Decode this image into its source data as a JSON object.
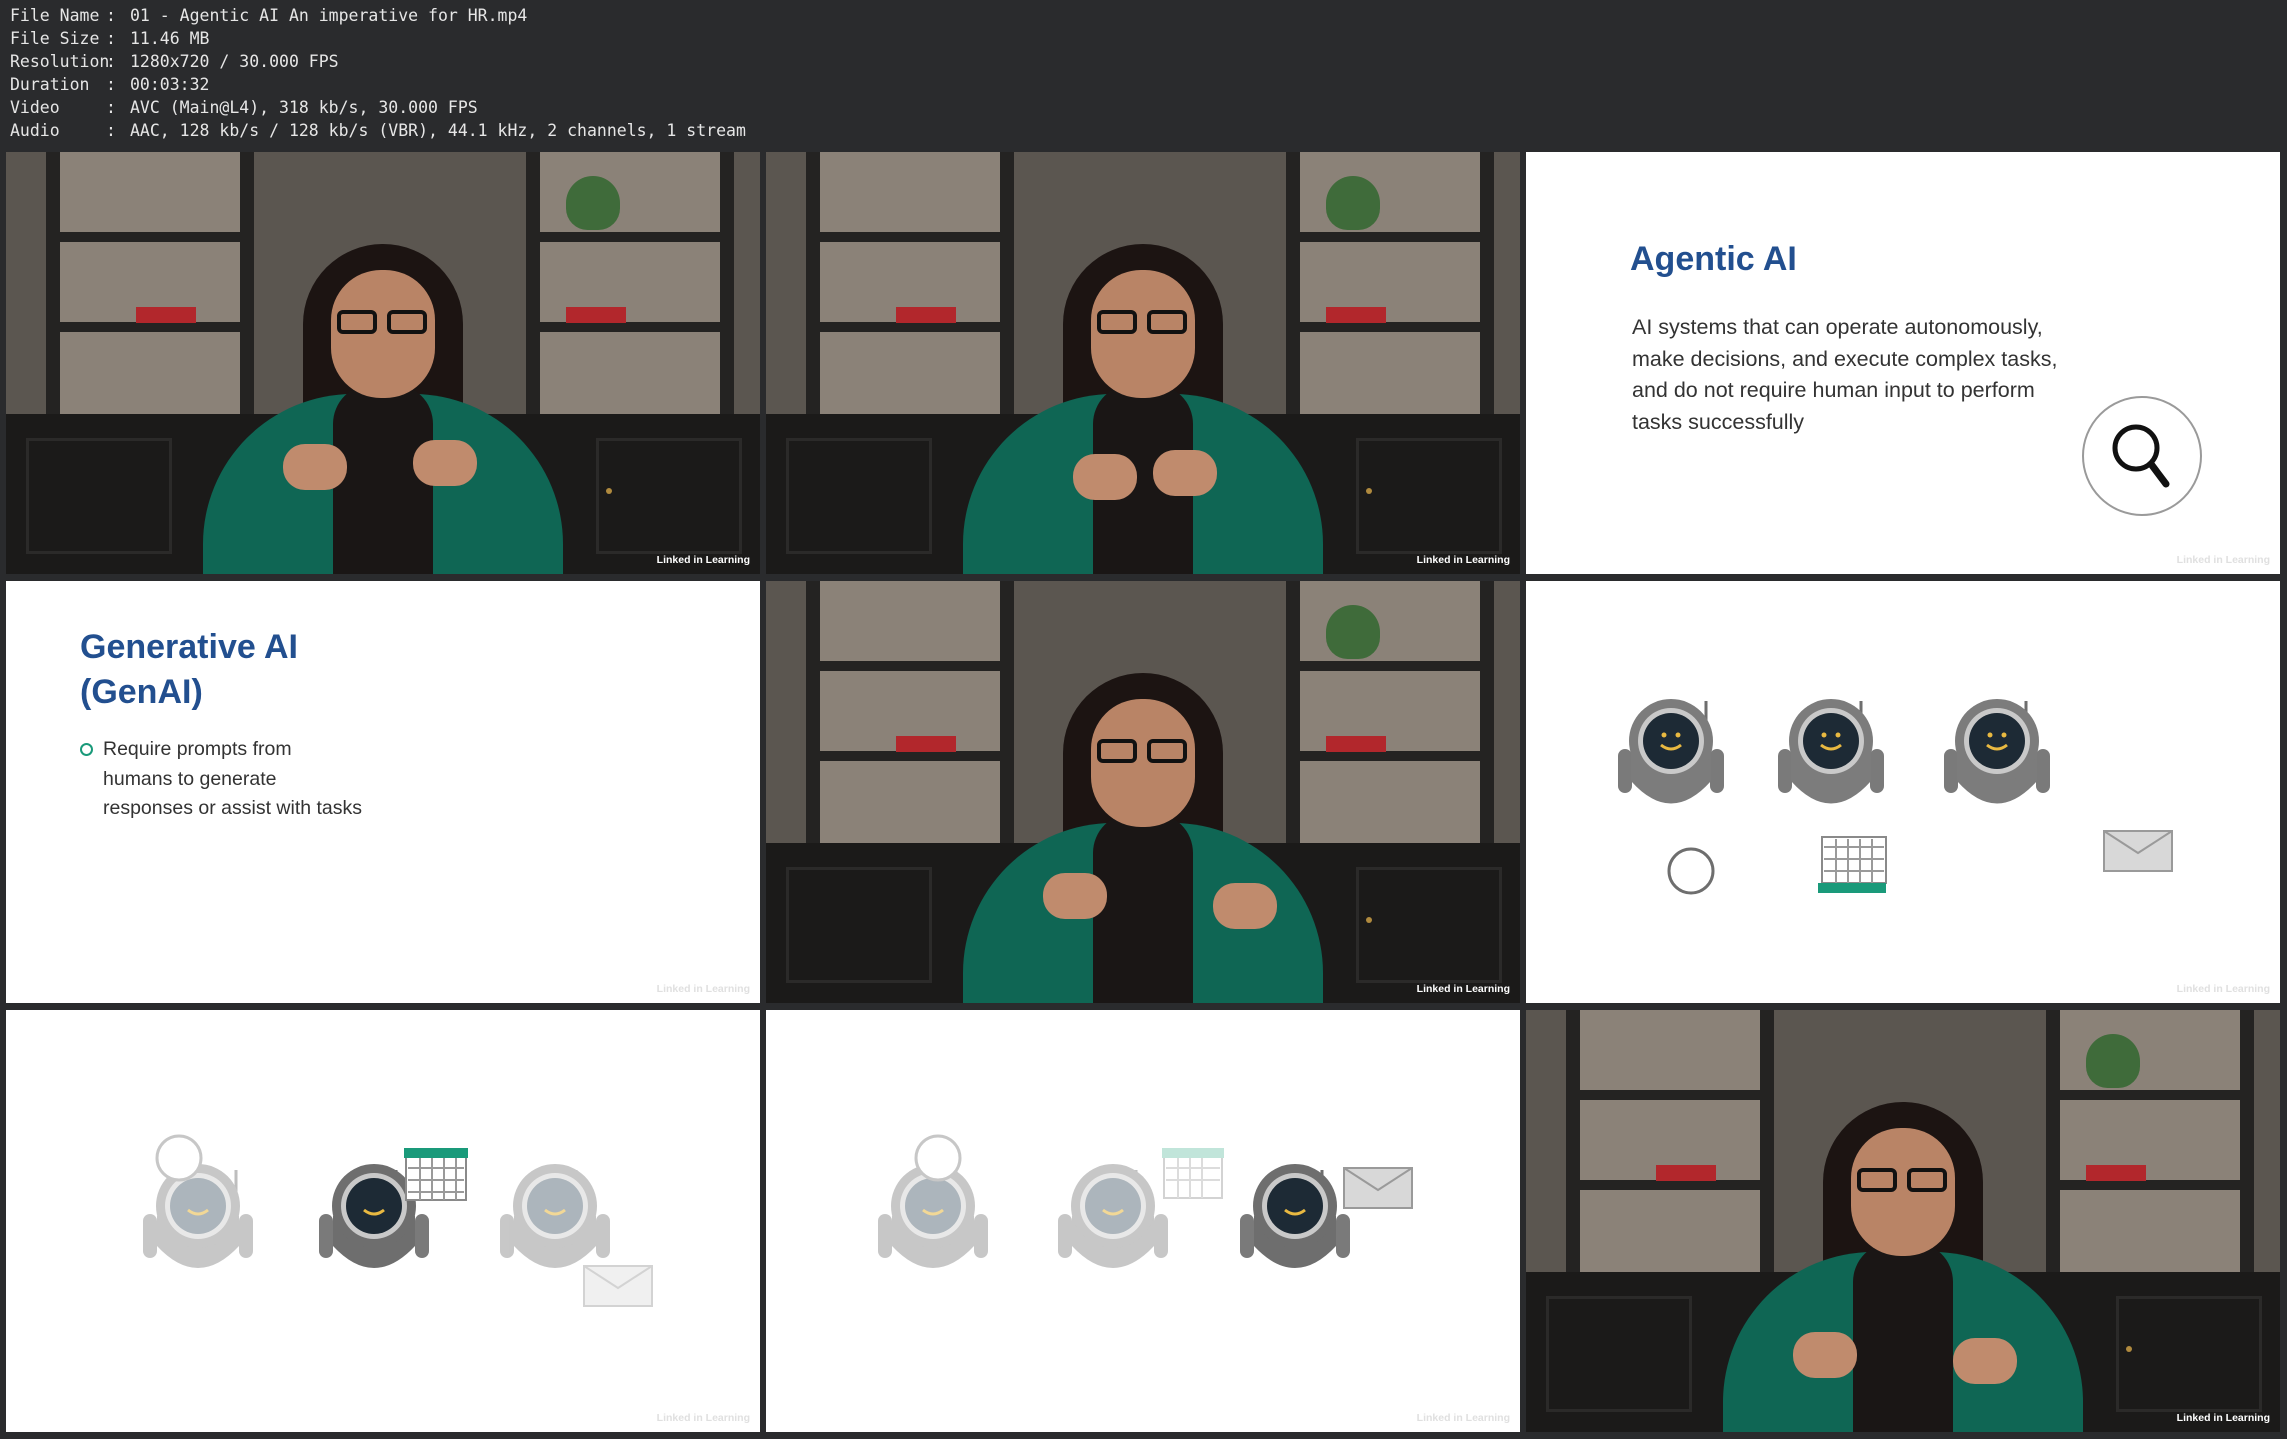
{
  "metadata": [
    {
      "key": "File Name",
      "sep": ":",
      "value": "01 - Agentic AI An imperative for HR.mp4"
    },
    {
      "key": "File Size",
      "sep": ":",
      "value": "11.46 MB"
    },
    {
      "key": "Resolution",
      "sep": ":",
      "value": "1280x720 / 30.000 FPS"
    },
    {
      "key": "Duration",
      "sep": ":",
      "value": "00:03:32"
    },
    {
      "key": "Video",
      "sep": ":",
      "value": "AVC (Main@L4), 318 kb/s, 30.000 FPS"
    },
    {
      "key": "Audio",
      "sep": ":",
      "value": "AAC, 128 kb/s / 128 kb/s (VBR), 44.1 kHz, 2 channels, 1 stream"
    }
  ],
  "watermark": "Linked in Learning",
  "slide_agentic": {
    "title": "Agentic AI",
    "body_lines": [
      "AI systems that can operate autonomously,",
      "make decisions, and execute complex tasks,",
      "and do not require human input to perform",
      "tasks successfully"
    ]
  },
  "slide_genai": {
    "title_lines": [
      "Generative AI",
      "(GenAI)"
    ],
    "bullet_lines": [
      "Require prompts from",
      "humans to generate",
      "responses or assist with tasks"
    ]
  },
  "colors": {
    "title_blue": "#224f8f",
    "accent_teal": "#1a9a7a",
    "robot_dark": "#6e6e6e",
    "robot_light": "#c9c9c9",
    "jacket_green": "#0f6654"
  }
}
